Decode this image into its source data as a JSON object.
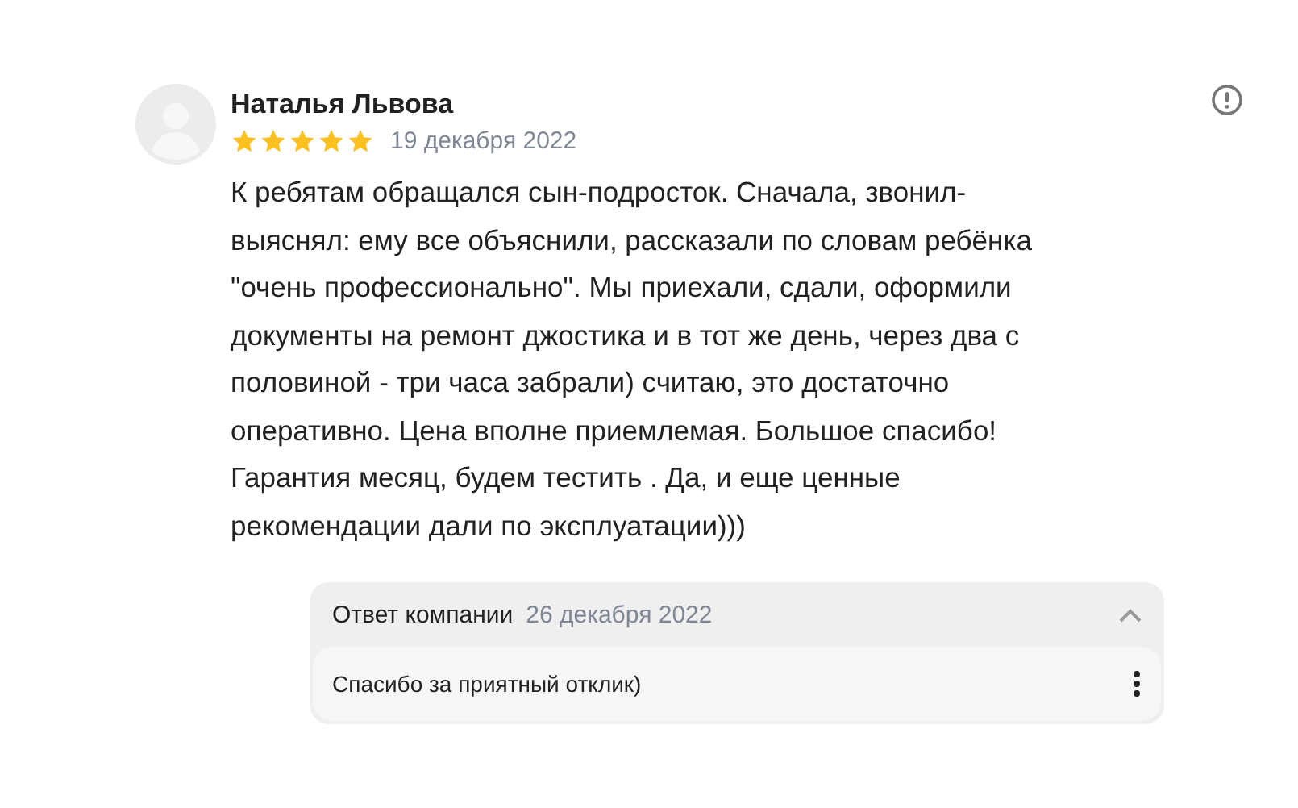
{
  "review": {
    "author": "Наталья Львова",
    "stars": 5,
    "date": "19 декабря 2022",
    "text": "К ребятам обращался сын-подросток. Сначала, звонил-\nвыяснял: ему все объяснили, рассказали по словам ребёнка\n\"очень профессионально\". Мы приехали, сдали, оформили\nдокументы на ремонт джостика и в тот же день, через два с\nполовиной - три часа забрали) считаю, это достаточно\nоперативно. Цена вполне приемлемая. Большое спасибо!\nГарантия месяц, будем тестить . Да, и еще ценные\nрекомендации дали по эксплуатации)))"
  },
  "company_reply": {
    "title": "Ответ компании",
    "date": "26 декабря 2022",
    "expanded": true,
    "text": "Спасибо за приятный отклик)"
  }
}
